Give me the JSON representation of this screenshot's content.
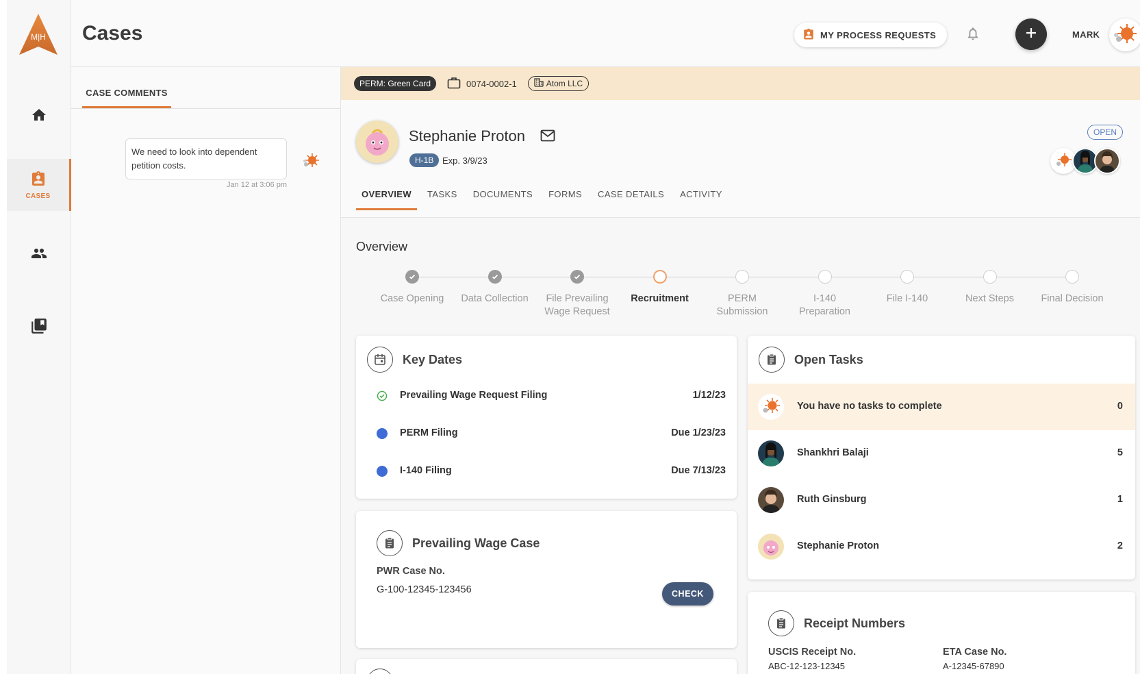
{
  "app": {
    "page_title": "Cases",
    "logo_text": "M|H",
    "brand_color": "#e07b39"
  },
  "sidebar": {
    "items": [
      {
        "icon": "home-icon",
        "label": ""
      },
      {
        "icon": "cases-icon",
        "label": "CASES",
        "active": true
      },
      {
        "icon": "people-icon",
        "label": ""
      },
      {
        "icon": "library-icon",
        "label": ""
      }
    ]
  },
  "header": {
    "process_requests_label": "MY PROCESS REQUESTS",
    "user_name": "MARK"
  },
  "comments": {
    "tab_label": "CASE COMMENTS",
    "items": [
      {
        "text": "We need to look into dependent petition costs.",
        "time": "Jan 12 at 3:06 pm"
      }
    ]
  },
  "case": {
    "type_chip": "PERM: Green Card",
    "case_number": "0074-0002-1",
    "company": "Atom LLC",
    "person_name": "Stephanie Proton",
    "visa": "H-1B",
    "visa_exp": "Exp. 3/9/23",
    "status": "OPEN"
  },
  "tabs": [
    {
      "label": "OVERVIEW",
      "active": true
    },
    {
      "label": "TASKS"
    },
    {
      "label": "DOCUMENTS"
    },
    {
      "label": "FORMS"
    },
    {
      "label": "CASE DETAILS"
    },
    {
      "label": "ACTIVITY"
    }
  ],
  "overview": {
    "title": "Overview",
    "steps": [
      {
        "line1": "Case Opening",
        "line2": "",
        "state": "done"
      },
      {
        "line1": "Data Collection",
        "line2": "",
        "state": "done"
      },
      {
        "line1": "File Prevailing",
        "line2": "Wage Request",
        "state": "done"
      },
      {
        "line1": "Recruitment",
        "line2": "",
        "state": "current"
      },
      {
        "line1": "PERM",
        "line2": "Submission",
        "state": "todo"
      },
      {
        "line1": "I-140",
        "line2": "Preparation",
        "state": "todo"
      },
      {
        "line1": "File I-140",
        "line2": "",
        "state": "todo"
      },
      {
        "line1": "Next Steps",
        "line2": "",
        "state": "todo"
      },
      {
        "line1": "Final Decision",
        "line2": "",
        "state": "todo"
      }
    ]
  },
  "key_dates": {
    "title": "Key Dates",
    "rows": [
      {
        "label": "Prevailing Wage Request Filing",
        "value": "1/12/23",
        "status": "complete"
      },
      {
        "label": "PERM Filing",
        "value": "Due 1/23/23",
        "status": "pending"
      },
      {
        "label": "I-140 Filing",
        "value": "Due 7/13/23",
        "status": "pending"
      }
    ]
  },
  "open_tasks": {
    "title": "Open Tasks",
    "rows": [
      {
        "label": "You have no tasks to complete",
        "count": "0",
        "avatar": "mascot"
      },
      {
        "label": "Shankhri Balaji",
        "count": "5",
        "avatar": "person-1"
      },
      {
        "label": "Ruth Ginsburg",
        "count": "1",
        "avatar": "person-2"
      },
      {
        "label": "Stephanie Proton",
        "count": "2",
        "avatar": "proton"
      }
    ]
  },
  "prevailing_wage": {
    "title": "Prevailing Wage Case",
    "field_label": "PWR Case No.",
    "field_value": "G-100-12345-123456",
    "check_label": "CHECK"
  },
  "receipt_numbers": {
    "title": "Receipt Numbers",
    "uscis_label": "USCIS Receipt No.",
    "uscis_value": "ABC-12-123-12345",
    "eta_label": "ETA Case No.",
    "eta_value": "A-12345-67890"
  }
}
